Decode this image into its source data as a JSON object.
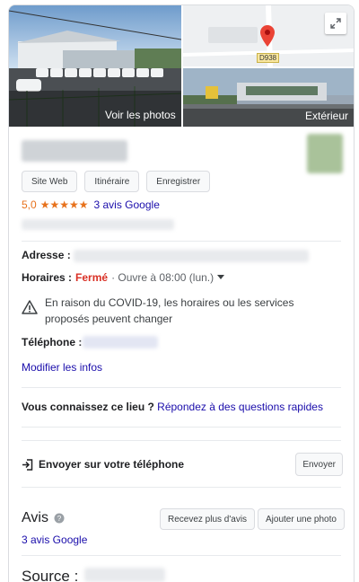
{
  "photos": {
    "main_label": "Voir les photos",
    "exterior_label": "Extérieur",
    "road_label": "D938"
  },
  "actions": {
    "website": "Site Web",
    "directions": "Itinéraire",
    "save": "Enregistrer"
  },
  "rating": {
    "score": "5,0",
    "stars": "★★★★★",
    "reviews_link": "3 avis Google"
  },
  "info": {
    "address_label": "Adresse :",
    "hours_label": "Horaires :",
    "hours_status": "Fermé",
    "hours_next": "· Ouvre à 08:00 (lun.)",
    "covid_notice": "En raison du COVID-19, les horaires ou les services proposés peuvent changer",
    "phone_label": "Téléphone :",
    "edit_link": "Modifier les infos"
  },
  "questions": {
    "prompt": "Vous connaissez ce lieu ?",
    "link": "Répondez à des questions rapides"
  },
  "send": {
    "label": "Envoyer sur votre téléphone",
    "button": "Envoyer"
  },
  "reviews": {
    "title": "Avis",
    "more_button": "Recevez plus d'avis",
    "add_photo_button": "Ajouter une photo",
    "count_link": "3 avis Google"
  },
  "source": {
    "label": "Source :"
  },
  "colors": {
    "link": "#1a0dab",
    "star": "#e7711b",
    "closed": "#d93025",
    "map_pin": "#ea4335"
  }
}
